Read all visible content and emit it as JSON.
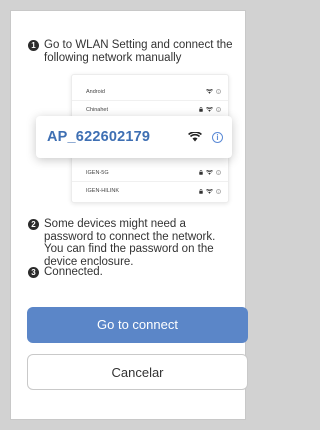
{
  "steps": [
    {
      "number": "1",
      "text": "Go to WLAN Setting and connect the following network manually"
    },
    {
      "number": "2",
      "text": "Some devices might need a password to connect the network. You can find the password on the device enclosure."
    },
    {
      "number": "3",
      "text": "Connected."
    }
  ],
  "wifi_list": {
    "networks": [
      {
        "name": "Android",
        "locked": false
      },
      {
        "name": "Chinahet",
        "locked": true
      },
      {
        "name": "IGEN-5G",
        "locked": true
      },
      {
        "name": "IGEN-HILINK",
        "locked": true
      }
    ],
    "highlighted": {
      "name": "AP_622602179"
    }
  },
  "buttons": {
    "connect_label": "Go to connect",
    "cancel_label": "Cancelar"
  },
  "colors": {
    "accent": "#5b86c8",
    "highlight_text": "#3e6fb3",
    "info_icon": "#5b8ad6"
  },
  "icons": [
    "wifi-icon",
    "lock-icon",
    "info-icon"
  ]
}
